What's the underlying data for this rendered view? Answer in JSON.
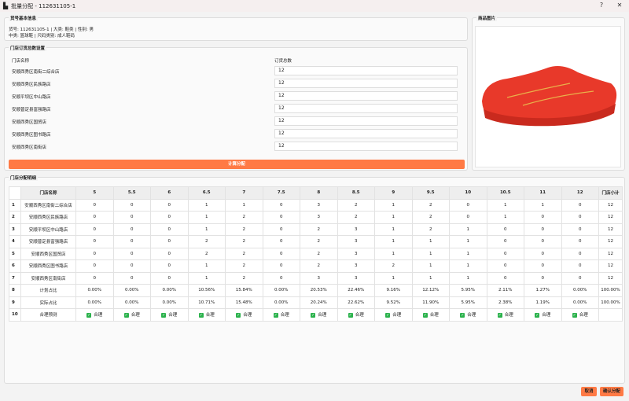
{
  "window": {
    "title": "批量分配 - 112631105-1",
    "help": "?",
    "close": "✕"
  },
  "basic": {
    "title": "货号基本信息",
    "line1": "货号: 112631105-1 | 大类: 鞋类 | 性别: 男",
    "line2": "中类: 篮球鞋 | 尺码类别: 成人鞋码"
  },
  "settings": {
    "title": "门店订货总数设置",
    "col_store": "门店名称",
    "col_total": "订货总数",
    "calc_label": "计算分配",
    "stores": [
      {
        "name": "安顺西秀区南街二综合店",
        "total": "12"
      },
      {
        "name": "安顺西秀区民族路店",
        "total": "12"
      },
      {
        "name": "安顺平坝区中山路店",
        "total": "12"
      },
      {
        "name": "安顺普定县富强路店",
        "total": "12"
      },
      {
        "name": "安顺西秀区国贸店",
        "total": "12"
      },
      {
        "name": "安顺西秀区图书路店",
        "total": "12"
      },
      {
        "name": "安顺西秀区南街店",
        "total": "12"
      }
    ]
  },
  "image_panel": {
    "title": "商品图片",
    "shoe_color": "#e8392a"
  },
  "detail": {
    "title": "门店分配明细",
    "headers": [
      "门店名称",
      "5",
      "5.5",
      "6",
      "6.5",
      "7",
      "7.5",
      "8",
      "8.5",
      "9",
      "9.5",
      "10",
      "10.5",
      "11",
      "12",
      "门店小计"
    ],
    "rows": [
      [
        "安顺西秀区南街二综合店",
        "0",
        "0",
        "0",
        "1",
        "1",
        "0",
        "3",
        "2",
        "1",
        "2",
        "0",
        "1",
        "1",
        "0",
        "12"
      ],
      [
        "安顺西秀区民族路店",
        "0",
        "0",
        "0",
        "1",
        "2",
        "0",
        "3",
        "2",
        "1",
        "2",
        "0",
        "1",
        "0",
        "0",
        "12"
      ],
      [
        "安顺平坝区中山路店",
        "0",
        "0",
        "0",
        "1",
        "2",
        "0",
        "2",
        "3",
        "1",
        "2",
        "1",
        "0",
        "0",
        "0",
        "12"
      ],
      [
        "安顺普定县富强路店",
        "0",
        "0",
        "0",
        "2",
        "2",
        "0",
        "2",
        "3",
        "1",
        "1",
        "1",
        "0",
        "0",
        "0",
        "12"
      ],
      [
        "安顺西秀区国贸店",
        "0",
        "0",
        "0",
        "2",
        "2",
        "0",
        "2",
        "3",
        "1",
        "1",
        "1",
        "0",
        "0",
        "0",
        "12"
      ],
      [
        "安顺西秀区图书路店",
        "0",
        "0",
        "0",
        "1",
        "2",
        "0",
        "2",
        "3",
        "2",
        "1",
        "1",
        "0",
        "0",
        "0",
        "12"
      ],
      [
        "安顺西秀区南街店",
        "0",
        "0",
        "0",
        "1",
        "2",
        "0",
        "3",
        "3",
        "1",
        "1",
        "1",
        "0",
        "0",
        "0",
        "12"
      ],
      [
        "计划占比",
        "0.00%",
        "0.00%",
        "0.00%",
        "10.56%",
        "15.84%",
        "0.00%",
        "20.53%",
        "22.46%",
        "9.16%",
        "12.12%",
        "5.95%",
        "2.11%",
        "1.27%",
        "0.00%",
        "100.00%"
      ],
      [
        "实际占比",
        "0.00%",
        "0.00%",
        "0.00%",
        "10.71%",
        "15.48%",
        "0.00%",
        "20.24%",
        "22.62%",
        "9.52%",
        "11.90%",
        "5.95%",
        "2.38%",
        "1.19%",
        "0.00%",
        "100.00%"
      ]
    ],
    "check_label": "合理预测",
    "ok_label": "合理"
  },
  "footer": {
    "cancel": "取消",
    "confirm": "确认分配"
  }
}
